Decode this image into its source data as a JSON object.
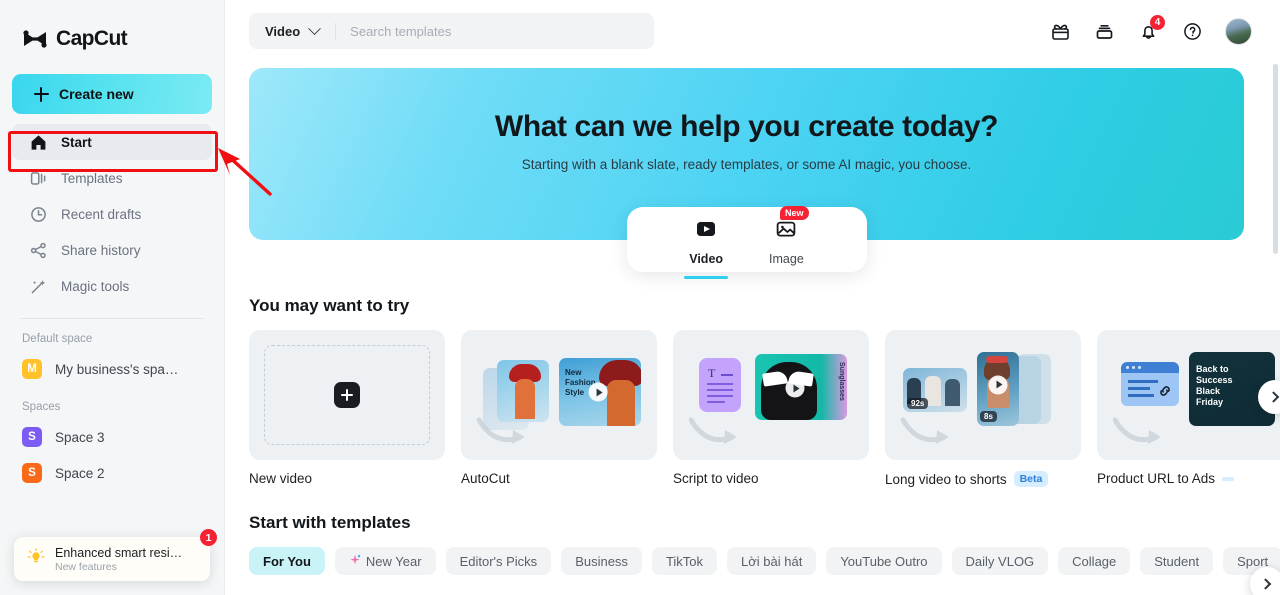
{
  "brand": {
    "name": "CapCut",
    "logo_icon": "capcut-logo-icon"
  },
  "sidebar": {
    "create_new_label": "Create new",
    "items": [
      {
        "label": "Start",
        "icon": "home-icon",
        "active": true
      },
      {
        "label": "Templates",
        "icon": "templates-icon",
        "active": false
      },
      {
        "label": "Recent drafts",
        "icon": "clock-icon",
        "active": false
      },
      {
        "label": "Share history",
        "icon": "share-icon",
        "active": false
      },
      {
        "label": "Magic tools",
        "icon": "magic-wand-icon",
        "active": false
      }
    ],
    "default_space_label": "Default space",
    "default_space": {
      "initial": "M",
      "label": "My business's spa…",
      "color": "#ffc229"
    },
    "spaces_label": "Spaces",
    "spaces": [
      {
        "initial": "S",
        "label": "Space 3",
        "color": "#7c5cf5"
      },
      {
        "initial": "S",
        "label": "Space 2",
        "color": "#f86a18"
      }
    ],
    "toast": {
      "icon": "lightbulb-icon",
      "title": "Enhanced smart resi…",
      "subtitle": "New features",
      "badge": "1"
    }
  },
  "topbar": {
    "search": {
      "scope": "Video",
      "placeholder": "Search templates",
      "value": ""
    },
    "icons": [
      {
        "name": "gift-icon"
      },
      {
        "name": "subscription-icon"
      },
      {
        "name": "bell-icon",
        "badge": "4"
      },
      {
        "name": "help-icon"
      }
    ],
    "avatar_name": "user-avatar"
  },
  "hero": {
    "title": "What can we help you create today?",
    "subtitle": "Starting with a blank slate, ready templates, or some AI magic, you choose.",
    "gradient_from": "#9fe8fa",
    "gradient_to": "#29cbd4",
    "tabs": [
      {
        "label": "Video",
        "icon": "video-play-icon",
        "active": true,
        "badge": ""
      },
      {
        "label": "Image",
        "icon": "image-icon",
        "active": false,
        "badge": "New"
      }
    ]
  },
  "try_section": {
    "title": "You may want to try",
    "cards": [
      {
        "label": "New video",
        "badge": "",
        "type": "new-video"
      },
      {
        "label": "AutoCut",
        "badge": "",
        "type": "autocut",
        "overlay_text": "New\nFashion\nStyle"
      },
      {
        "label": "Script to video",
        "badge": "",
        "type": "script-to-video",
        "overlay_text": "Sunglasses"
      },
      {
        "label": "Long video to shorts",
        "badge": "Beta",
        "type": "long-to-shorts",
        "clip_labels": [
          "92s",
          "8s"
        ]
      },
      {
        "label": "Product URL to Ads",
        "badge": "",
        "type": "url-to-ads",
        "overlay_text": "Back to Success Black Friday"
      }
    ],
    "next_button_icon": "chevron-right-icon"
  },
  "templates_section": {
    "title": "Start with templates",
    "chips": [
      {
        "label": "For You",
        "active": true,
        "icon": ""
      },
      {
        "label": "New Year",
        "active": false,
        "icon": "sparkle-icon"
      },
      {
        "label": "Editor's Picks",
        "active": false,
        "icon": ""
      },
      {
        "label": "Business",
        "active": false,
        "icon": ""
      },
      {
        "label": "TikTok",
        "active": false,
        "icon": ""
      },
      {
        "label": "Lời bài hát",
        "active": false,
        "icon": ""
      },
      {
        "label": "YouTube Outro",
        "active": false,
        "icon": ""
      },
      {
        "label": "Daily VLOG",
        "active": false,
        "icon": ""
      },
      {
        "label": "Collage",
        "active": false,
        "icon": ""
      },
      {
        "label": "Student",
        "active": false,
        "icon": ""
      },
      {
        "label": "Sport",
        "active": false,
        "icon": ""
      }
    ],
    "next_button_icon": "chevron-right-icon"
  },
  "annotations": {
    "highlight_target": "Start",
    "arrow_color": "#f00f12"
  }
}
